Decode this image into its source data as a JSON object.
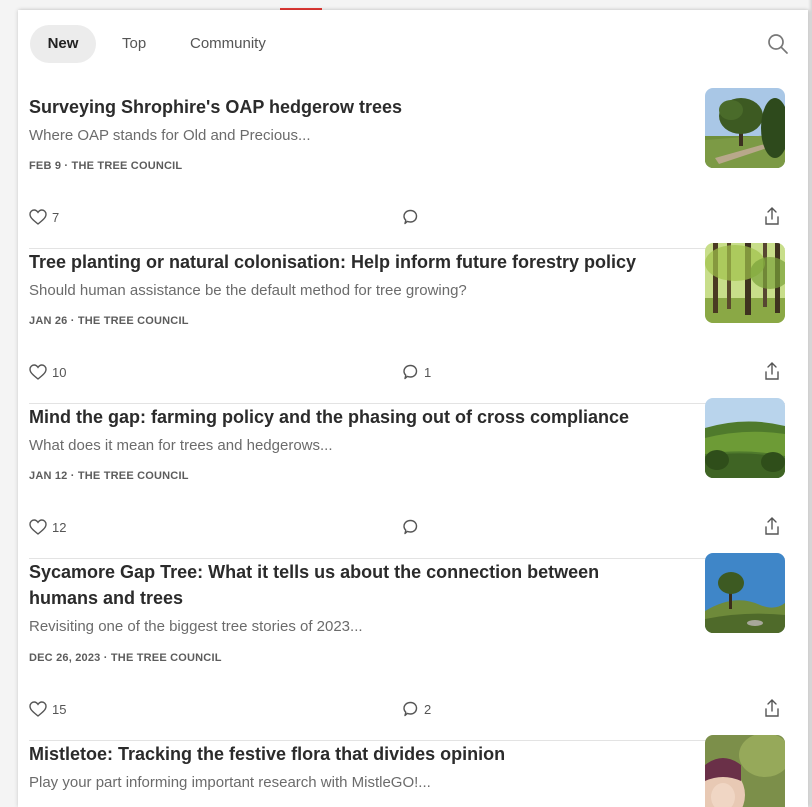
{
  "tabs": [
    {
      "label": "New",
      "active": true
    },
    {
      "label": "Top",
      "active": false
    },
    {
      "label": "Community",
      "active": false
    }
  ],
  "icons": {
    "search": "search-icon",
    "like": "heart-icon",
    "comment": "comment-icon",
    "share": "share-icon"
  },
  "accent_color": "#e53935",
  "posts": [
    {
      "title": "Surveying Shrophire's OAP hedgerow trees",
      "subtitle": "Where OAP stands for Old and Precious...",
      "meta": "FEB 9 · THE TREE COUNCIL",
      "likes": "7",
      "comments": ""
    },
    {
      "title": "Tree planting or natural colonisation: Help inform future forestry policy",
      "subtitle": "Should human assistance be the default method for tree growing?",
      "meta": "JAN 26 · THE TREE COUNCIL",
      "likes": "10",
      "comments": "1"
    },
    {
      "title": "Mind the gap: farming policy and the phasing out of cross compliance",
      "subtitle": "What does it mean for trees and hedgerows...",
      "meta": "JAN 12 · THE TREE COUNCIL",
      "likes": "12",
      "comments": ""
    },
    {
      "title": "Sycamore Gap Tree: What it tells us about the connection between humans and trees",
      "subtitle": "Revisiting one of the biggest tree stories of 2023...",
      "meta": "DEC 26, 2023 · THE TREE COUNCIL",
      "likes": "15",
      "comments": "2"
    },
    {
      "title": "Mistletoe: Tracking the festive flora that divides opinion",
      "subtitle": "Play your part informing important research with MistleGO!..."
    }
  ]
}
